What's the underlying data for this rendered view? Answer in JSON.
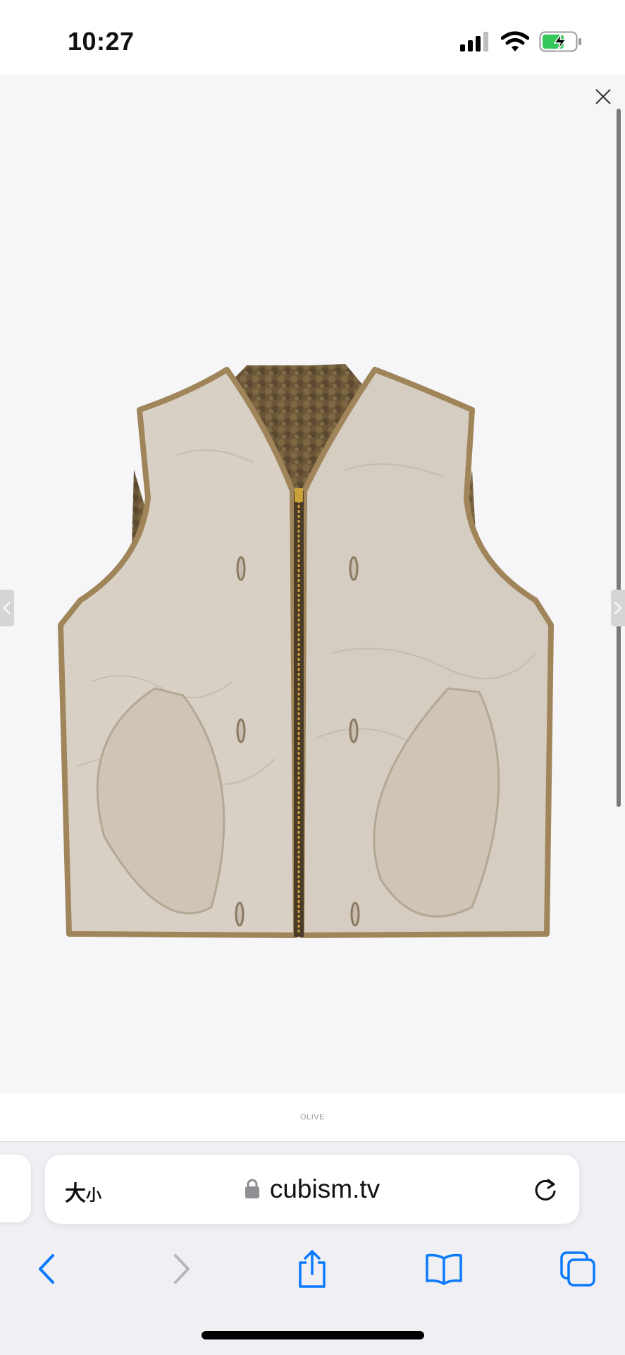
{
  "status_bar": {
    "time": "10:27",
    "icons": [
      "cellular-signal-icon",
      "wifi-icon",
      "battery-charging-icon"
    ]
  },
  "viewer": {
    "close_icon": "close-icon",
    "prev_icon": "chevron-left-icon",
    "next_icon": "chevron-right-icon",
    "image_subject": "product photo",
    "caption": "OLIVE"
  },
  "browser": {
    "text_size_label_big": "大",
    "text_size_label_small": "小",
    "url": "cubism.tv",
    "lock_icon": "lock-icon",
    "reload_icon": "reload-icon",
    "toolbar": [
      "back-icon",
      "forward-icon",
      "share-icon",
      "bookmarks-icon",
      "tabs-icon"
    ]
  },
  "colors": {
    "accent": "#0a7aff",
    "disabled": "#b7b7bb",
    "battery_green": "#34c759"
  }
}
